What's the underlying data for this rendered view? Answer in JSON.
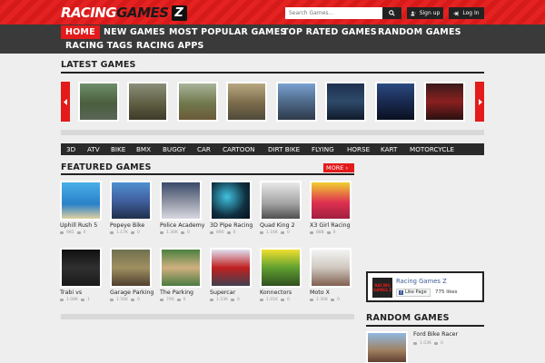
{
  "logo": {
    "part1": "RACING",
    "part2": "GAMES",
    "part3": "Z"
  },
  "search": {
    "placeholder": "Search Games..."
  },
  "auth": {
    "signup": "Sign up",
    "login": "Log In"
  },
  "nav": [
    {
      "label": "HOME",
      "active": true
    },
    {
      "label": "NEW GAMES"
    },
    {
      "label": "MOST POPULAR GAMES"
    },
    {
      "label": "TOP RATED GAMES"
    },
    {
      "label": "RANDOM GAMES"
    },
    {
      "label": "RACING TAGS"
    },
    {
      "label": "RACING APPS"
    }
  ],
  "latest": {
    "title": "LATEST GAMES"
  },
  "tags": [
    "3D",
    "ATV",
    "BIKE",
    "BMX",
    "BUGGY",
    "CAR",
    "CARTOON",
    "DIRT BIKE",
    "FLYING",
    "HORSE",
    "KART",
    "MOTORCYCLE"
  ],
  "featured": {
    "title": "FEATURED GAMES",
    "more": "MORE",
    "games": [
      {
        "name": "Uphill Rush 5",
        "plays": "985",
        "likes": "0"
      },
      {
        "name": "Popeye Bike",
        "plays": "1.17K",
        "likes": "0"
      },
      {
        "name": "Police Academy",
        "plays": "1.30K",
        "likes": "0"
      },
      {
        "name": "3D Pipe Racing",
        "plays": "890",
        "likes": "0"
      },
      {
        "name": "Quad King 2",
        "plays": "1.16K",
        "likes": "0"
      },
      {
        "name": "X3 Girl Racing",
        "plays": "888",
        "likes": "0"
      },
      {
        "name": "Trabi vs",
        "plays": "1.08K",
        "likes": "1"
      },
      {
        "name": "Garage Parking",
        "plays": "1.56K",
        "likes": "0"
      },
      {
        "name": "The Parking",
        "plays": "790",
        "likes": "0"
      },
      {
        "name": "Supercar",
        "plays": "1.53K",
        "likes": "0"
      },
      {
        "name": "Konnectors",
        "plays": "1.01K",
        "likes": "0"
      },
      {
        "name": "Moto X",
        "plays": "1.30K",
        "likes": "0"
      }
    ]
  },
  "facebook": {
    "page_name": "Racing Games Z",
    "like_label": "Like Page",
    "likes": "775 likes",
    "logo_text": "RACING GAMES Z"
  },
  "random": {
    "title": "RANDOM GAMES",
    "games": [
      {
        "name": "Ford Bike Racer",
        "plays": "1.03K",
        "likes": "0"
      }
    ]
  },
  "colors": {
    "accent": "#e31b1b",
    "dark": "#222222",
    "nav": "#3a3a3a"
  }
}
